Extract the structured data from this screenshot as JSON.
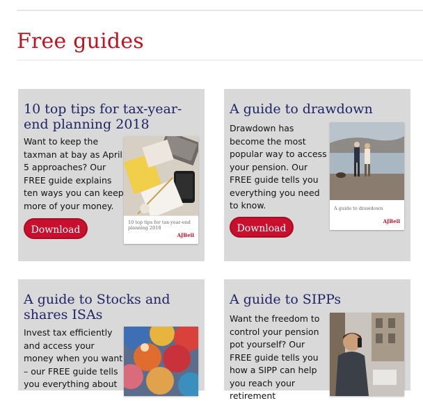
{
  "section": {
    "title": "Free guides"
  },
  "guides": [
    {
      "title": "10 top tips for tax-year-end planning 2018",
      "description": "Want to keep the taxman at bay as April 5 approaches? Our FREE guide explains ten ways you can keep more of your money.",
      "button": "Download",
      "cover_caption": "10 top tips for tax-year-end planning 2018",
      "cover_logo": "AJBell"
    },
    {
      "title": "A guide to drawdown",
      "description": "Drawdown has become the most popular way to access your pension. Our FREE guide tells you everything you need to know.",
      "button": "Download",
      "cover_caption": "A guide to drawdown",
      "cover_logo": "AJBell"
    },
    {
      "title": "A guide to Stocks and shares ISAs",
      "description": "Invest tax efficiently and access your money when you want – our FREE guide tells you everything about"
    },
    {
      "title": "A guide to SIPPs",
      "description": "Want the freedom to control your pension pot yourself? Our FREE guide tells you how a SIPP can help you reach your retirement"
    }
  ],
  "colors": {
    "brand_red": "#c8102e",
    "title_navy": "#1f2466",
    "card_bg": "#d9d9d9"
  }
}
